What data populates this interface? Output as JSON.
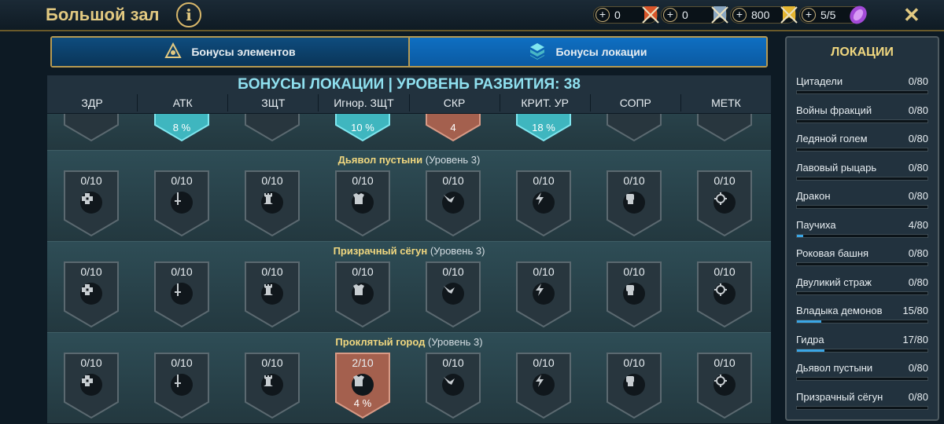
{
  "window": {
    "title": "Большой зал",
    "info_icon": "info-icon",
    "close_icon": "close-icon"
  },
  "resources": [
    {
      "value": "0",
      "icon": "red-banner-icon",
      "color": "#d8552a"
    },
    {
      "value": "0",
      "icon": "blue-banner-icon",
      "color": "#8aa7c2"
    },
    {
      "value": "800",
      "icon": "gold-banner-icon",
      "color": "#e5b630"
    },
    {
      "value": "5/5",
      "icon": "purple-gem-icon",
      "color": "#a34ad8"
    }
  ],
  "tabs": [
    {
      "label": "Бонусы элементов",
      "icon": "elements-icon",
      "active": false
    },
    {
      "label": "Бонусы локации",
      "icon": "location-icon",
      "active": true
    }
  ],
  "header": {
    "title": "БОНУСЫ ЛОКАЦИИ | УРОВЕНЬ РАЗВИТИЯ: 38",
    "columns": [
      "ЗДР",
      "АТК",
      "ЗЩТ",
      "Игнор. ЗЩТ",
      "СКР",
      "КРИТ. УР",
      "СОПР",
      "МЕТК"
    ]
  },
  "summary_row": [
    {
      "pct": "",
      "style": "dark"
    },
    {
      "pct": "8 %",
      "style": "teal"
    },
    {
      "pct": "",
      "style": "dark"
    },
    {
      "pct": "10 %",
      "style": "teal"
    },
    {
      "pct": "4",
      "style": "copper"
    },
    {
      "pct": "18 %",
      "style": "teal"
    },
    {
      "pct": "",
      "style": "dark"
    },
    {
      "pct": "",
      "style": "dark"
    }
  ],
  "stat_icons": [
    "health-icon",
    "sword-icon",
    "tower-icon",
    "armor-icon",
    "wing-icon",
    "lightning-icon",
    "fist-icon",
    "target-icon"
  ],
  "sections": [
    {
      "name": "Дьявол пустыни",
      "level": "(Уровень 3)",
      "cells": [
        {
          "count": "0/10",
          "pct": "",
          "style": "dark"
        },
        {
          "count": "0/10",
          "pct": "",
          "style": "dark"
        },
        {
          "count": "0/10",
          "pct": "",
          "style": "dark"
        },
        {
          "count": "0/10",
          "pct": "",
          "style": "dark"
        },
        {
          "count": "0/10",
          "pct": "",
          "style": "dark"
        },
        {
          "count": "0/10",
          "pct": "",
          "style": "dark"
        },
        {
          "count": "0/10",
          "pct": "",
          "style": "dark"
        },
        {
          "count": "0/10",
          "pct": "",
          "style": "dark"
        }
      ]
    },
    {
      "name": "Призрачный сёгун",
      "level": "(Уровень 3)",
      "cells": [
        {
          "count": "0/10",
          "pct": "",
          "style": "dark"
        },
        {
          "count": "0/10",
          "pct": "",
          "style": "dark"
        },
        {
          "count": "0/10",
          "pct": "",
          "style": "dark"
        },
        {
          "count": "0/10",
          "pct": "",
          "style": "dark"
        },
        {
          "count": "0/10",
          "pct": "",
          "style": "dark"
        },
        {
          "count": "0/10",
          "pct": "",
          "style": "dark"
        },
        {
          "count": "0/10",
          "pct": "",
          "style": "dark"
        },
        {
          "count": "0/10",
          "pct": "",
          "style": "dark"
        }
      ]
    },
    {
      "name": "Проклятый город",
      "level": "(Уровень 3)",
      "cells": [
        {
          "count": "0/10",
          "pct": "",
          "style": "dark"
        },
        {
          "count": "0/10",
          "pct": "",
          "style": "dark"
        },
        {
          "count": "0/10",
          "pct": "",
          "style": "dark"
        },
        {
          "count": "2/10",
          "pct": "4 %",
          "style": "copper"
        },
        {
          "count": "0/10",
          "pct": "",
          "style": "dark"
        },
        {
          "count": "0/10",
          "pct": "",
          "style": "dark"
        },
        {
          "count": "0/10",
          "pct": "",
          "style": "dark"
        },
        {
          "count": "0/10",
          "pct": "",
          "style": "dark"
        }
      ]
    }
  ],
  "sidebar": {
    "title": "ЛОКАЦИИ",
    "items": [
      {
        "name": "Цитадели",
        "count": "0/80",
        "progress": 0
      },
      {
        "name": "Войны фракций",
        "count": "0/80",
        "progress": 0
      },
      {
        "name": "Ледяной голем",
        "count": "0/80",
        "progress": 0
      },
      {
        "name": "Лавовый рыцарь",
        "count": "0/80",
        "progress": 0
      },
      {
        "name": "Дракон",
        "count": "0/80",
        "progress": 0
      },
      {
        "name": "Паучиха",
        "count": "4/80",
        "progress": 0.05
      },
      {
        "name": "Роковая башня",
        "count": "0/80",
        "progress": 0
      },
      {
        "name": "Двуликий страж",
        "count": "0/80",
        "progress": 0
      },
      {
        "name": "Владыка демонов",
        "count": "15/80",
        "progress": 0.1875
      },
      {
        "name": "Гидра",
        "count": "17/80",
        "progress": 0.2125
      },
      {
        "name": "Дьявол пустыни",
        "count": "0/80",
        "progress": 0
      },
      {
        "name": "Призрачный сёгун",
        "count": "0/80",
        "progress": 0
      }
    ]
  },
  "colors": {
    "teal": "#3fb6bf",
    "copper": "#a4604e",
    "dark": "#28363e",
    "accent_gold": "#e2c981"
  }
}
